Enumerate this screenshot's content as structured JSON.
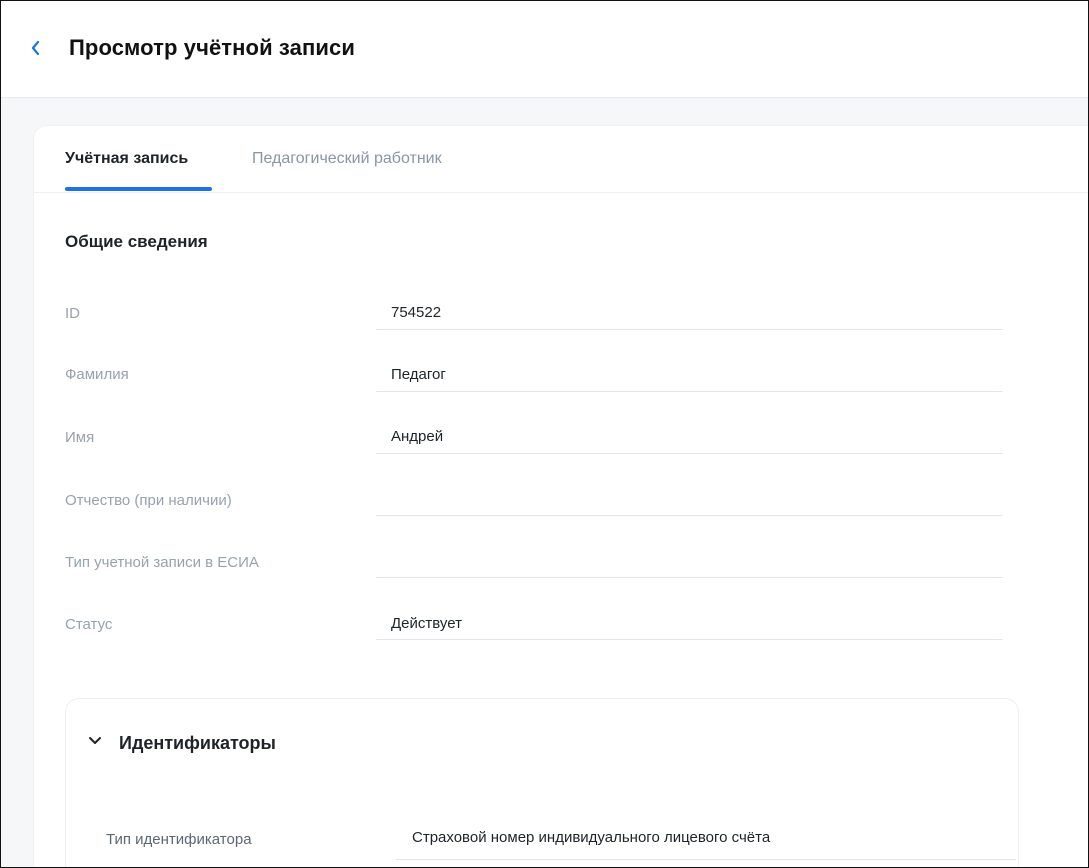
{
  "header": {
    "title": "Просмотр учётной записи",
    "back_icon": "chevron-left-icon"
  },
  "tabs": [
    {
      "label": "Учётная запись",
      "active": true
    },
    {
      "label": "Педагогический работник",
      "active": false
    }
  ],
  "general": {
    "title": "Общие сведения",
    "fields": [
      {
        "label": "ID",
        "value": "754522"
      },
      {
        "label": "Фамилия",
        "value": "Педагог"
      },
      {
        "label": "Имя",
        "value": "Андрей"
      },
      {
        "label": "Отчество (при наличии)",
        "value": ""
      },
      {
        "label": "Тип учетной записи в ЕСИА",
        "value": ""
      },
      {
        "label": "Статус",
        "value": "Действует"
      }
    ]
  },
  "identifiers": {
    "title": "Идентификаторы",
    "expanded": true,
    "toggle_icon": "chevron-down-icon",
    "type_label": "Тип идентификатора",
    "type_value": "Страховой номер индивидуального лицевого счёта"
  },
  "colors": {
    "accent": "#1f73e0",
    "label": "#98a1ad",
    "text": "#1f2328",
    "border": "#e3e7ec",
    "page_bg": "#f6f7f8"
  }
}
